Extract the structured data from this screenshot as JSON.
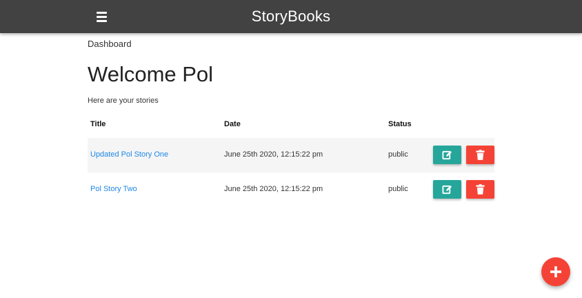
{
  "navbar": {
    "brand": "StoryBooks",
    "menu_icon": "menu-icon",
    "background": "#424242"
  },
  "breadcrumb": "Dashboard",
  "welcome": "Welcome Pol",
  "subtitle": "Here are your stories",
  "table": {
    "headers": [
      "Title",
      "Date",
      "Status"
    ],
    "rows": [
      {
        "title": "Updated Pol Story One",
        "date": "June 25th 2020, 12:15:22 pm",
        "status": "public"
      },
      {
        "title": "Pol Story Two",
        "date": "June 25th 2020, 12:15:22 pm",
        "status": "public"
      }
    ],
    "edit_icon": "edit-icon",
    "delete_icon": "trash-icon"
  },
  "fab": {
    "icon": "plus-icon"
  },
  "colors": {
    "edit": "#26a69a",
    "delete": "#f44336",
    "fab": "#f44336",
    "link": "#1e88e5"
  }
}
